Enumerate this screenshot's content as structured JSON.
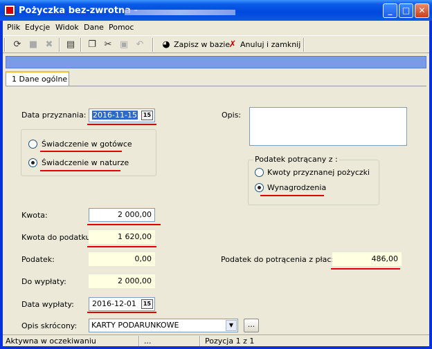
{
  "window": {
    "title": "Pożyczka bez-zwrotna -",
    "minimize_glyph": "_",
    "maximize_glyph": "□",
    "close_glyph": "✕"
  },
  "menu": [
    "Plik",
    "Edycje",
    "Widok",
    "Dane",
    "Pomoc"
  ],
  "toolbar": {
    "save_db_label": "Zapisz w bazie",
    "cancel_close_label": "Anuluj i zamknij"
  },
  "tabs": [
    {
      "label": "1 Dane ogólne"
    }
  ],
  "form": {
    "data_przyznania": {
      "label": "Data przyznania:",
      "value": "2016-11-15"
    },
    "opis": {
      "label": "Opis:",
      "value": ""
    },
    "swiadczenie": {
      "option_gotowka": "Świadczenie w gotówce",
      "option_natura": "Świadczenie w naturze",
      "selected": "natura"
    },
    "podatek_potracany": {
      "title": "Podatek potrącany z :",
      "option_pozyczka": "Kwoty przyznanej pożyczki",
      "option_wynagrodzenie": "Wynagrodzenia",
      "selected": "wynagrodzenie"
    },
    "kwota": {
      "label": "Kwota:",
      "value": "2 000,00"
    },
    "kwota_do_podatku": {
      "label": "Kwota do podatku:",
      "value": "1 620,00"
    },
    "podatek": {
      "label": "Podatek:",
      "value": "0,00"
    },
    "podatek_do_potracenia": {
      "label": "Podatek do potrącenia z płac:",
      "value": "486,00"
    },
    "do_wyplaty": {
      "label": "Do wypłaty:",
      "value": "2 000,00"
    },
    "data_wyplaty": {
      "label": "Data wypłaty:",
      "value": "2016-12-01"
    },
    "opis_skrocony": {
      "label": "Opis skrócony:",
      "value": "KARTY PODARUNKOWE",
      "button": "..."
    },
    "calendar_glyph": "15"
  },
  "statusbar": {
    "status": "Aktywna w oczekiwaniu",
    "middle": "...",
    "position": "Pozycja 1 z 1"
  },
  "colors": {
    "titlebar": "#0a5be8",
    "highlight_line": "#e00000",
    "readonly_field": "#ffffe1",
    "progress_bar": "#7b9ae8"
  }
}
